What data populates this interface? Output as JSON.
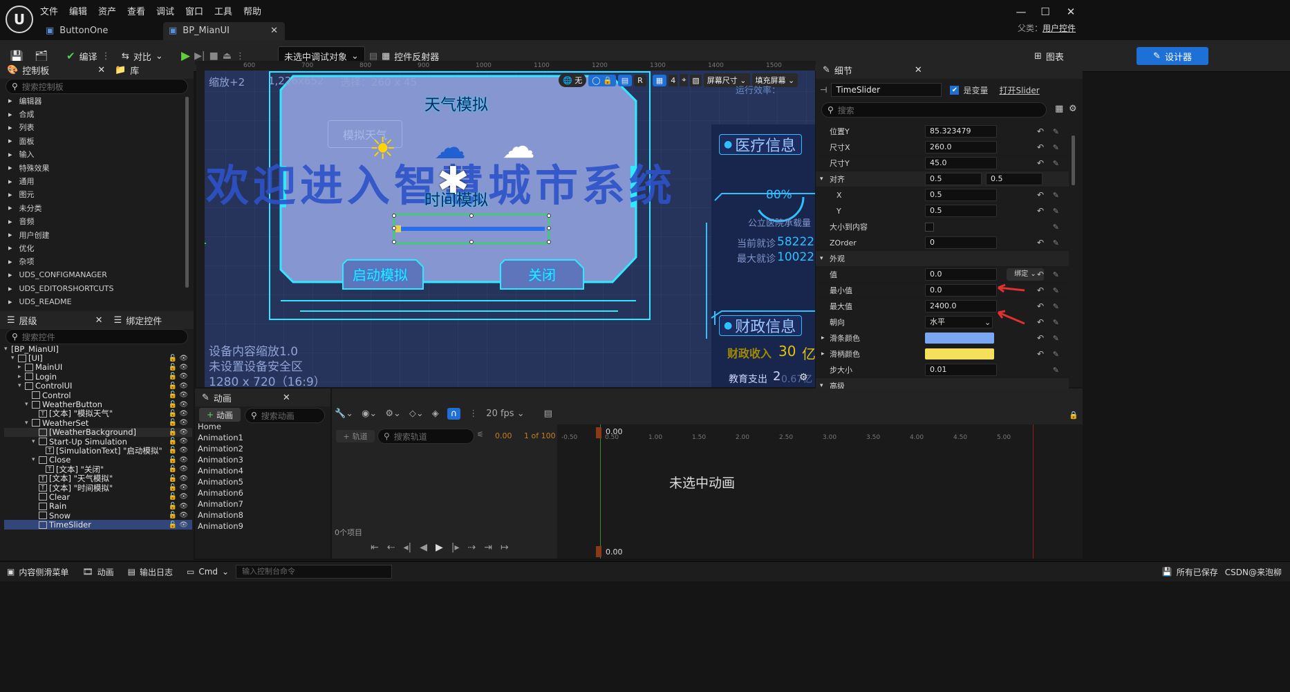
{
  "menu": [
    "文件",
    "编辑",
    "资产",
    "查看",
    "调试",
    "窗口",
    "工具",
    "帮助"
  ],
  "tabs": [
    {
      "label": "ButtonOne"
    },
    {
      "label": "BP_MianUI"
    }
  ],
  "parent": {
    "label": "父类：",
    "value": "用户控件"
  },
  "toolbar": {
    "compile": "编译",
    "diff": "对比",
    "debug_target": "未选中调试对象",
    "reflector": "控件反射器",
    "designer": "设计器",
    "graph": "图表"
  },
  "palette": {
    "title": "控制板",
    "library": "库",
    "search_placeholder": "搜索控制板",
    "items": [
      "编辑器",
      "合成",
      "列表",
      "面板",
      "输入",
      "特殊效果",
      "通用",
      "图元",
      "未分类",
      "音频",
      "用户创建",
      "优化",
      "杂项",
      "UDS_CONFIGMANAGER",
      "UDS_EDITORSHORTCUTS",
      "UDS_README"
    ]
  },
  "hierarchy": {
    "title": "层级",
    "bind": "绑定控件",
    "search_placeholder": "搜索控件",
    "rows": [
      {
        "label": "[BP_MianUI]",
        "indent": 0
      },
      {
        "label": "[UI]",
        "indent": 1
      },
      {
        "label": "MainUI",
        "indent": 2
      },
      {
        "label": "Login",
        "indent": 2
      },
      {
        "label": "ControlUI",
        "indent": 2
      },
      {
        "label": "Control",
        "indent": 3
      },
      {
        "label": "WeatherButton",
        "indent": 3
      },
      {
        "label": "[文本] \"模拟天气\"",
        "indent": 4
      },
      {
        "label": "WeatherSet",
        "indent": 3
      },
      {
        "label": "[WeatherBackground]",
        "indent": 4
      },
      {
        "label": "Start-Up Simulation",
        "indent": 4
      },
      {
        "label": "[SimulationText] \"启动模拟\"",
        "indent": 5
      },
      {
        "label": "Close",
        "indent": 4
      },
      {
        "label": "[文本] \"关闭\"",
        "indent": 5
      },
      {
        "label": "[文本] \"天气模拟\"",
        "indent": 4
      },
      {
        "label": "[文本] \"时间模拟\"",
        "indent": 4
      },
      {
        "label": "Clear",
        "indent": 4
      },
      {
        "label": "Rain",
        "indent": 4
      },
      {
        "label": "Snow",
        "indent": 4
      },
      {
        "label": "TimeSlider",
        "indent": 4
      }
    ]
  },
  "viewport": {
    "zoom": "缩放+2",
    "resolution": "1,226x652",
    "selection": "选择：260 x 45",
    "ruler": [
      "600",
      "700",
      "800",
      "900",
      "1000",
      "1100",
      "1200",
      "1300",
      "1400",
      "1500"
    ],
    "no_label": "无",
    "r_label": "R",
    "grid_num": "4",
    "screen_size": "屏幕尺寸",
    "fill_screen": "填充屏幕",
    "run_eff": "运行效率：",
    "banner": "欢迎进入智慧城市系统",
    "weather_title": "天气模拟",
    "simulate_weather": "模拟天气",
    "time_title": "时间模拟",
    "btn_start": "启动模拟",
    "btn_close": "关闭",
    "medical": "医疗信息",
    "percent": "80%",
    "hospital": "公立医院承载量",
    "current": "当前就诊",
    "current_val": "58222",
    "max": "最大就诊",
    "max_val": "10022",
    "finance": "财政信息",
    "revenue": "财政收入",
    "revenue_val": "30",
    "revenue_unit": "亿",
    "edu": "教育支出",
    "edu_val": "2",
    "edu_suffix": "0.67亿",
    "info1": "设备内容缩放1.0",
    "info2": "未设置设备安全区",
    "info3": "1280 x 720（16:9）"
  },
  "details": {
    "title": "细节",
    "name": "TimeSlider",
    "is_var": "是变量",
    "open": "打开Slider",
    "search_placeholder": "搜索",
    "rows": [
      {
        "label": "位置Y",
        "value": "85.323479"
      },
      {
        "label": "尺寸X",
        "value": "260.0"
      },
      {
        "label": "尺寸Y",
        "value": "45.0"
      },
      {
        "label": "对齐",
        "value": "0.5",
        "value2": "0.5"
      },
      {
        "label": "X",
        "value": "0.5"
      },
      {
        "label": "Y",
        "value": "0.5"
      },
      {
        "label": "大小到内容",
        "value": ""
      },
      {
        "label": "ZOrder",
        "value": "0"
      },
      {
        "label": "外观",
        "value": ""
      },
      {
        "label": "值",
        "value": "0.0",
        "extra": "绑定"
      },
      {
        "label": "最小值",
        "value": "0.0"
      },
      {
        "label": "最大值",
        "value": "2400.0"
      },
      {
        "label": "朝向",
        "value": "水平"
      },
      {
        "label": "滑条颜色",
        "value": ""
      },
      {
        "label": "滑柄颜色",
        "value": ""
      },
      {
        "label": "步大小",
        "value": "0.01"
      },
      {
        "label": "高级",
        "value": ""
      }
    ],
    "bar_color": "#7aa7f2",
    "handle_color": "#f4e05a"
  },
  "animation": {
    "title": "动画",
    "add": "动画",
    "search_placeholder": "搜索动画",
    "items": [
      "Home",
      "Animation1",
      "Animation2",
      "Animation3",
      "Animation4",
      "Animation5",
      "Animation6",
      "Animation7",
      "Animation8",
      "Animation9"
    ],
    "fps": "20 fps",
    "track": "轨道",
    "search_track": "搜索轨道",
    "time": "0.00",
    "frame": "1 of 100",
    "count": "0个项目",
    "none_selected": "未选中动画",
    "marker": "0.00",
    "ruler": [
      "-0.50",
      "0.50",
      "1.00",
      "1.50",
      "2.00",
      "2.50",
      "3.00",
      "3.50",
      "4.00",
      "4.50",
      "5.00"
    ]
  },
  "status": {
    "drawer": "内容侧滑菜单",
    "anim": "动画",
    "log": "输出日志",
    "cmd": "Cmd",
    "cmd_placeholder": "输入控制台命令",
    "saved": "所有已保存",
    "source": "CSDN@来泡柳"
  }
}
